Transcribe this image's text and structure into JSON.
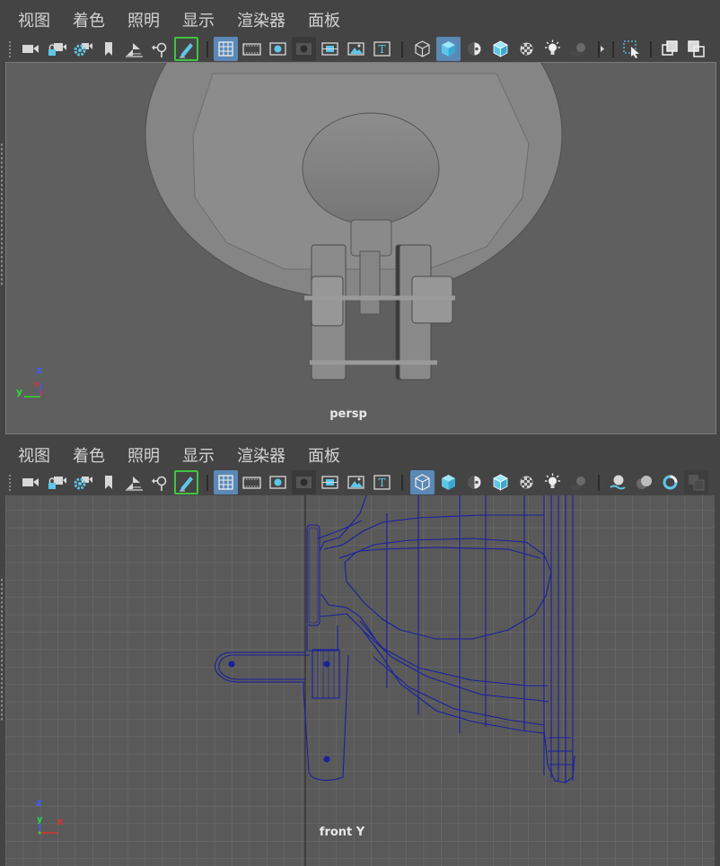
{
  "menus": [
    "视图",
    "着色",
    "照明",
    "显示",
    "渲染器",
    "面板"
  ],
  "icons": {
    "camera": "camera-icon",
    "lock_camera": "lock-camera-icon",
    "camera_attributes": "camera-attributes-icon",
    "bookmark": "bookmark-icon",
    "image_plane": "image-plane-icon",
    "pan_zoom": "pan-zoom-icon",
    "grease_pencil": "grease-pencil-icon",
    "grid": "grid-icon",
    "film_gate": "film-gate-icon",
    "resolution_gate": "resolution-gate-icon",
    "gate_mask": "gate-mask-icon",
    "field_chart": "field-chart-icon",
    "safe_action": "safe-action-icon",
    "safe_title": "safe-title-icon",
    "wireframe": "wireframe-icon",
    "smooth_shade": "smooth-shade-icon",
    "default_material": "default-material-icon",
    "wireframe_on_shaded": "wireframe-on-shaded-icon",
    "textured": "textured-icon",
    "use_all_lights": "use-all-lights-icon",
    "shadows": "shadows-icon",
    "ambient_occlusion": "ambient-occlusion-icon",
    "motion_blur": "motion-blur-icon",
    "anti_aliasing": "anti-aliasing-icon",
    "isolate_select": "isolate-select-icon",
    "xray": "xray-icon",
    "xray_joints": "xray-joints-icon"
  },
  "colors": {
    "panel_bg": "#444444",
    "menu_text": "#d2d2d2",
    "active_button": "#5b89b6",
    "pencil_outline": "#41c441",
    "persp_bg": "#5f5f5f",
    "front_bg": "#595959",
    "wireframe": "#1a1f9e",
    "axis_x": "#e03030",
    "axis_y": "#33d633",
    "axis_z": "#3f5cff"
  },
  "viewports": {
    "top": {
      "camera": "persp",
      "axes": {
        "x": "x",
        "y": "y",
        "z": "z"
      }
    },
    "bottom": {
      "camera": "front Y",
      "axes": {
        "x": "x",
        "y": "y",
        "z": "z"
      }
    }
  }
}
